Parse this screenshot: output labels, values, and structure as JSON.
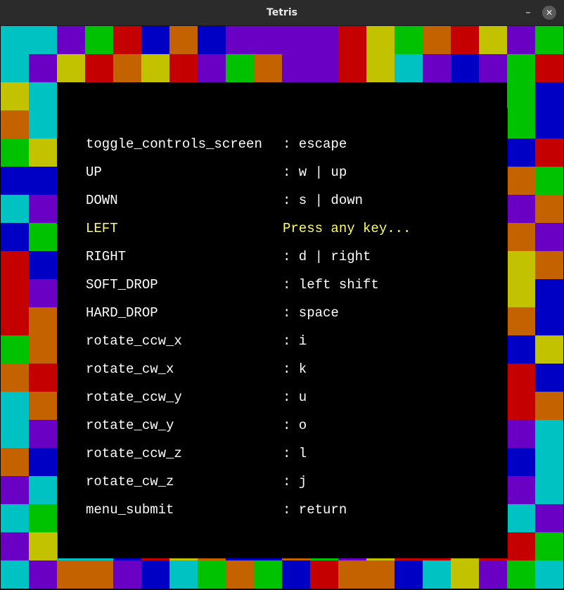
{
  "window": {
    "title": "Tetris",
    "minimize_glyph": "–",
    "close_glyph": "✕"
  },
  "palette": {
    "C": "#00c2c2",
    "P": "#6a00c4",
    "G": "#00c200",
    "R": "#c40000",
    "B": "#0000c4",
    "O": "#c46200",
    "Y": "#c2c200"
  },
  "border_grid": [
    "CCPGRBOBPPPPRYGORYPG",
    "CPYROYRPGOPPRYCPBPGR",
    "YC................GB",
    "OC................GB",
    "GY................BR",
    "BB................OG",
    "CP................PO",
    "BG................OP",
    "RB................YO",
    "RP................YB",
    "RO................OB",
    "GO................BY",
    "OR................RB",
    "CO................RO",
    "CP................PC",
    "OB................BC",
    "PC................PC",
    "CG................CP",
    "PYCCBRYOBBOGPYRRYRRG",
    "CPOOPBCGOGBROOBCYPGC"
  ],
  "controls": {
    "selected_index": 3,
    "rows": [
      {
        "action": "toggle_controls_screen",
        "binding": ": escape"
      },
      {
        "action": "UP",
        "binding": ": w | up"
      },
      {
        "action": "DOWN",
        "binding": ": s | down"
      },
      {
        "action": "LEFT",
        "binding": "Press any key..."
      },
      {
        "action": "RIGHT",
        "binding": ": d | right"
      },
      {
        "action": "SOFT_DROP",
        "binding": ": left shift"
      },
      {
        "action": "HARD_DROP",
        "binding": ": space"
      },
      {
        "action": "rotate_ccw_x",
        "binding": ": i"
      },
      {
        "action": "rotate_cw_x",
        "binding": ": k"
      },
      {
        "action": "rotate_ccw_y",
        "binding": ": u"
      },
      {
        "action": "rotate_cw_y",
        "binding": ": o"
      },
      {
        "action": "rotate_ccw_z",
        "binding": ": l"
      },
      {
        "action": "rotate_cw_z",
        "binding": ": j"
      },
      {
        "action": "menu_submit",
        "binding": ": return"
      }
    ],
    "normal_color": "#ffffff",
    "selected_color": "#ffff66"
  }
}
